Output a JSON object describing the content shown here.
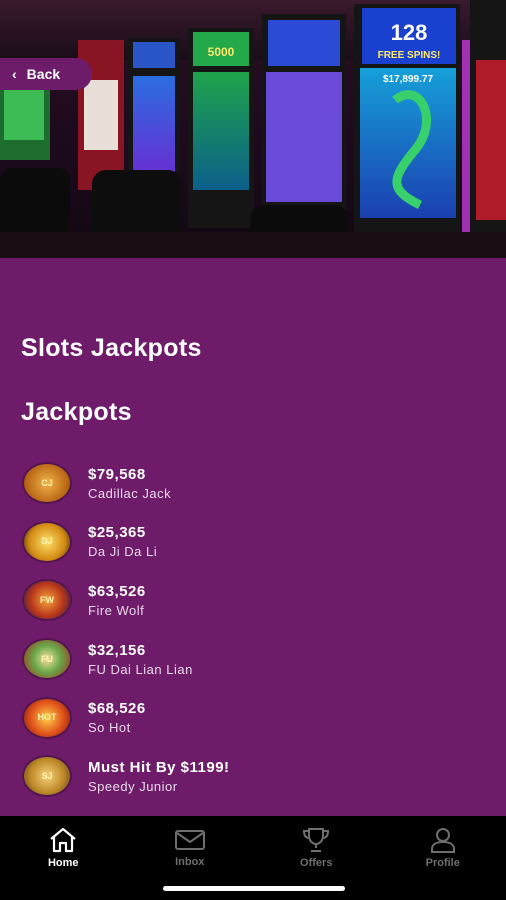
{
  "header": {
    "back_label": "Back"
  },
  "hero": {
    "machine_screens": [
      "128",
      "FREE SPINS!",
      "$17,899.77",
      "5000"
    ]
  },
  "main": {
    "title": "Slots Jackpots",
    "section_title": "Jackpots",
    "jackpots": [
      {
        "amount": "$79,568",
        "name": "Cadillac Jack",
        "icon": "cadillac-jack-logo",
        "color": "#c9791a"
      },
      {
        "amount": "$25,365",
        "name": "Da Ji Da Li",
        "icon": "da-ji-da-li-logo",
        "color": "#e2b21f"
      },
      {
        "amount": "$63,526",
        "name": "Fire Wolf",
        "icon": "fire-wolf-logo",
        "color": "#c1421c"
      },
      {
        "amount": "$32,156",
        "name": "FU Dai Lian Lian",
        "icon": "fu-dai-lian-lian-logo",
        "color": "#3f8d2a"
      },
      {
        "amount": "$68,526",
        "name": "So Hot",
        "icon": "so-hot-logo",
        "color": "#d1401a"
      },
      {
        "amount": "Must Hit By $1199!",
        "name": "Speedy Junior",
        "icon": "speedy-junior-logo",
        "color": "#b7932c"
      }
    ]
  },
  "nav": {
    "items": [
      {
        "label": "Home",
        "icon": "home-icon",
        "active": true
      },
      {
        "label": "Inbox",
        "icon": "mail-icon",
        "active": false
      },
      {
        "label": "Offers",
        "icon": "trophy-icon",
        "active": false
      },
      {
        "label": "Profile",
        "icon": "person-icon",
        "active": false
      }
    ]
  },
  "colors": {
    "background": "#6e1c6a",
    "nav_background": "#000000",
    "nav_active": "#ffffff",
    "nav_inactive": "#6e6e6e"
  }
}
